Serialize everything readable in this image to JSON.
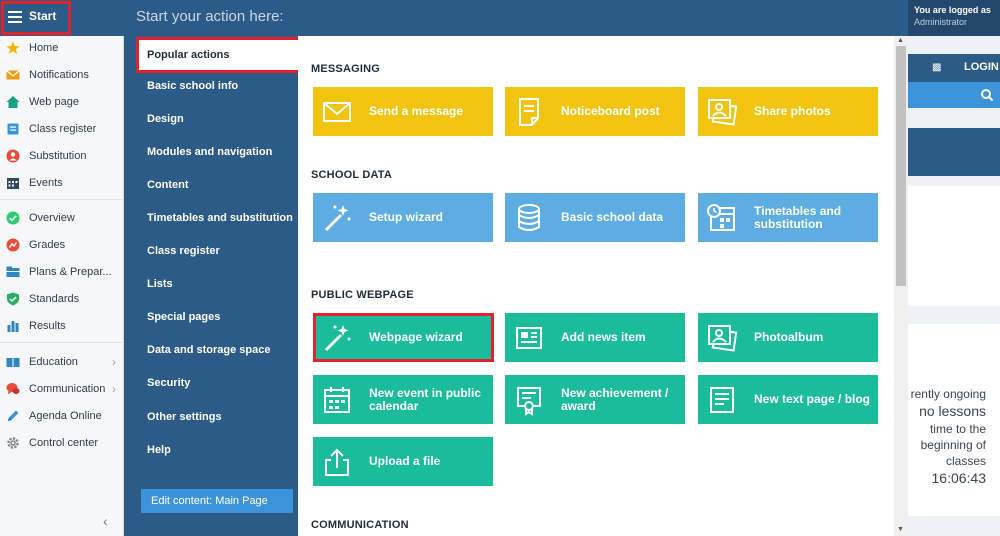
{
  "start": {
    "label": "Start"
  },
  "topbar": {
    "prompt": "Start your action here:"
  },
  "user": {
    "logged_as": "You are logged as",
    "name": "Administrator"
  },
  "sidebar": {
    "items": [
      {
        "label": "Home",
        "icon": "star-icon"
      },
      {
        "label": "Notifications",
        "icon": "envelope-icon"
      },
      {
        "label": "Web page",
        "icon": "house-icon"
      },
      {
        "label": "Class register",
        "icon": "register-icon"
      },
      {
        "label": "Substitution",
        "icon": "substitution-icon"
      },
      {
        "label": "Events",
        "icon": "calendar-icon"
      },
      {
        "label": "Overview",
        "icon": "check-circle-icon"
      },
      {
        "label": "Grades",
        "icon": "grades-icon"
      },
      {
        "label": "Plans & Prepar...",
        "icon": "folder-icon"
      },
      {
        "label": "Standards",
        "icon": "shield-check-icon"
      },
      {
        "label": "Results",
        "icon": "bar-chart-icon"
      },
      {
        "label": "Education",
        "icon": "book-icon"
      },
      {
        "label": "Communication",
        "icon": "chat-icon"
      },
      {
        "label": "Agenda Online",
        "icon": "pencil-icon"
      },
      {
        "label": "Control center",
        "icon": "gear-icon"
      }
    ]
  },
  "categories": {
    "popular": "Popular actions",
    "items": [
      "Basic school info",
      "Design",
      "Modules and navigation",
      "Content",
      "Timetables and substitution",
      "Class register",
      "Lists",
      "Special pages",
      "Data and storage space",
      "Security",
      "Other settings",
      "Help"
    ],
    "edit_content": "Edit content: Main Page"
  },
  "sections": {
    "messaging": "MESSAGING",
    "school_data": "SCHOOL DATA",
    "public_webpage": "PUBLIC WEBPAGE",
    "communication": "COMMUNICATION"
  },
  "tiles": {
    "send_message": "Send a message",
    "noticeboard": "Noticeboard post",
    "share_photos": "Share photos",
    "setup_wizard": "Setup wizard",
    "basic_school_data": "Basic school data",
    "timetables_l1": "Timetables and",
    "timetables_l2": "substitution",
    "webpage_wizard": "Webpage wizard",
    "add_news": "Add news item",
    "photoalbum": "Photoalbum",
    "new_event_l1": "New event in public",
    "new_event_l2": "calendar",
    "achievement_l1": "New achievement /",
    "achievement_l2": "award",
    "text_page": "New text page / blog",
    "upload": "Upload a file"
  },
  "right": {
    "login": "LOGIN",
    "ongoing": "rently ongoing",
    "no_lessons": "no lessons",
    "time_to": "time to the",
    "beginning": "beginning of",
    "classes": "classes",
    "clock": "16:06:43"
  },
  "colors": {
    "brand": "#2b5b86",
    "yellow": "#f1c40f",
    "blue": "#5dade2",
    "green": "#1abc9c",
    "highlight": "#e3232c"
  }
}
